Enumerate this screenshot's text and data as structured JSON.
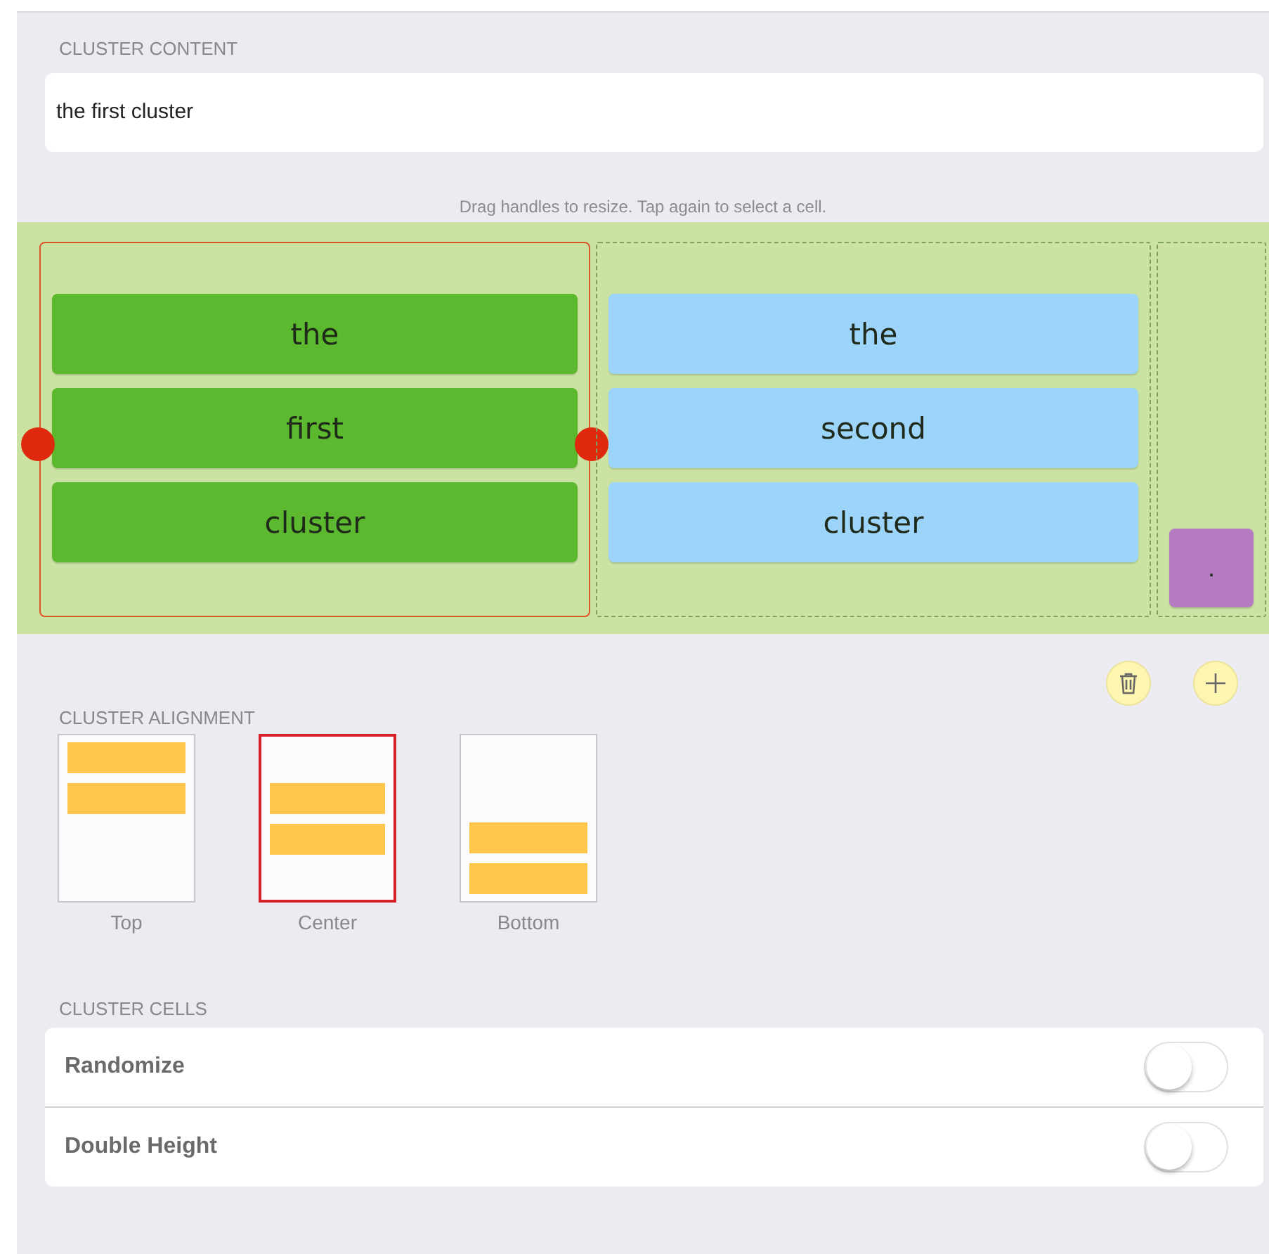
{
  "content": {
    "label": "CLUSTER CONTENT",
    "value": "the first cluster"
  },
  "hint": "Drag handles to resize. Tap again to select a cell.",
  "clusters": [
    {
      "selected": true,
      "kind": "center",
      "color": "#5cb82e",
      "words": [
        "the",
        "first",
        "cluster"
      ]
    },
    {
      "selected": false,
      "kind": "center",
      "color": "#9dd4fa",
      "words": [
        "the",
        "second",
        "cluster"
      ]
    },
    {
      "selected": false,
      "kind": "bottom",
      "color": "#b57cc4",
      "words": [
        "."
      ]
    }
  ],
  "alignment": {
    "label": "CLUSTER ALIGNMENT",
    "options": [
      {
        "label": "Top",
        "kind": "top",
        "selected": false
      },
      {
        "label": "Center",
        "kind": "center",
        "selected": true
      },
      {
        "label": "Bottom",
        "kind": "bottom",
        "selected": false
      }
    ]
  },
  "cells": {
    "label": "CLUSTER CELLS",
    "rows": [
      {
        "label": "Randomize",
        "on": false
      },
      {
        "label": "Double Height",
        "on": false
      }
    ]
  }
}
